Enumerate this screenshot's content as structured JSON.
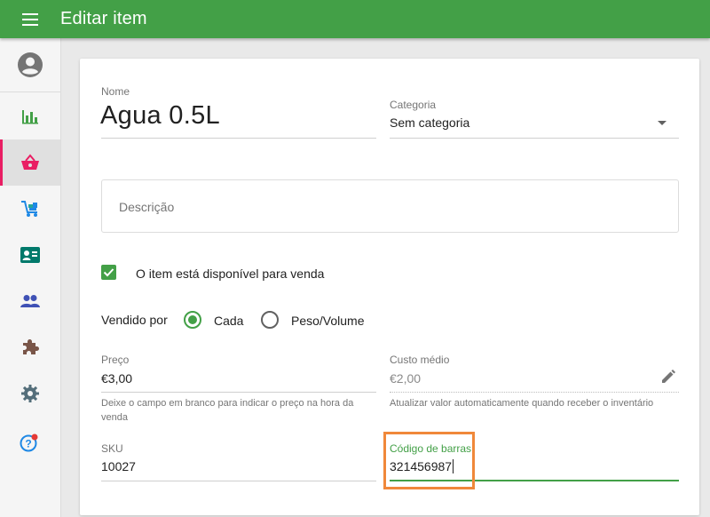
{
  "appbar": {
    "title": "Editar item"
  },
  "sidebar": {
    "items": [
      {
        "name": "account"
      },
      {
        "name": "reports"
      },
      {
        "name": "items",
        "active": true
      },
      {
        "name": "inventory"
      },
      {
        "name": "employees"
      },
      {
        "name": "customers"
      },
      {
        "name": "integrations"
      },
      {
        "name": "settings"
      },
      {
        "name": "help"
      }
    ]
  },
  "form": {
    "name": {
      "label": "Nome",
      "value": "Agua 0.5L"
    },
    "category": {
      "label": "Categoria",
      "value": "Sem categoria"
    },
    "description": {
      "placeholder": "Descrição"
    },
    "available": {
      "label": "O item está disponível para venda",
      "checked": true
    },
    "sold_by": {
      "label": "Vendido por",
      "options": [
        "Cada",
        "Peso/Volume"
      ],
      "selected": "Cada"
    },
    "price": {
      "label": "Preço",
      "value": "€3,00",
      "helper_line1": "Deixe o campo em branco para indicar o preço na hora da",
      "helper_line2": "venda"
    },
    "cost": {
      "label": "Custo médio",
      "value": "€2,00",
      "helper": "Atualizar valor automaticamente quando receber o inventário"
    },
    "sku": {
      "label": "SKU",
      "value": "10027"
    },
    "barcode": {
      "label": "Código de barras",
      "value": "321456987"
    }
  },
  "colors": {
    "primary": "#43a047",
    "accent": "#e91e63",
    "highlight": "#f0883a"
  }
}
